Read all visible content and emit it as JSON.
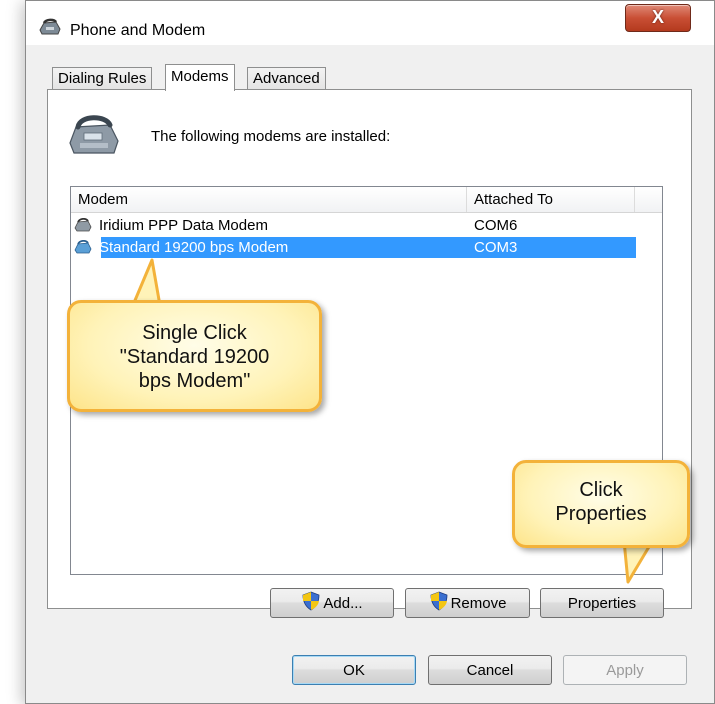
{
  "window": {
    "title": "Phone and Modem",
    "close_label": "X"
  },
  "tabs": [
    {
      "label": "Dialing Rules",
      "active": false
    },
    {
      "label": "Modems",
      "active": true
    },
    {
      "label": "Advanced",
      "active": false
    }
  ],
  "intro_text": "The following modems are installed:",
  "modem_list": {
    "columns": [
      "Modem",
      "Attached To"
    ],
    "rows": [
      {
        "modem": "Iridium PPP Data Modem",
        "attached_to": "COM6",
        "selected": false
      },
      {
        "modem": "Standard 19200 bps Modem",
        "attached_to": "COM3",
        "selected": true
      }
    ]
  },
  "list_buttons": {
    "add": "Add...",
    "remove": "Remove",
    "properties": "Properties"
  },
  "dialog_buttons": {
    "ok": "OK",
    "cancel": "Cancel",
    "apply": "Apply"
  },
  "callouts": {
    "select_line1": "Single Click",
    "select_line2": "\"Standard 19200",
    "select_line3": "bps Modem\"",
    "properties_line1": "Click",
    "properties_line2": "Properties"
  },
  "colors": {
    "selection": "#3399ff",
    "callout_border": "#f3b23a",
    "callout_fill": "#fff3b8"
  },
  "icons": [
    "phone-modem-icon",
    "close-icon",
    "modem-icon",
    "uac-shield-icon"
  ]
}
